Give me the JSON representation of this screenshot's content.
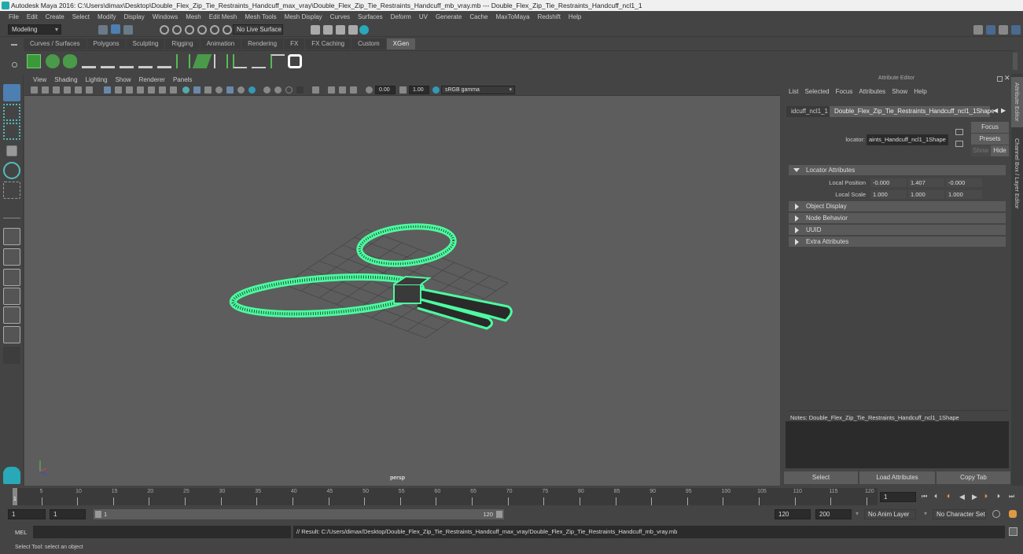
{
  "window": {
    "title": "Autodesk Maya 2016: C:\\Users\\dimax\\Desktop\\Double_Flex_Zip_Tie_Restraints_Handcuff_max_vray\\Double_Flex_Zip_Tie_Restraints_Handcuff_mb_vray.mb  ---  Double_Flex_Zip_Tie_Restraints_Handcuff_ncl1_1"
  },
  "menubar": [
    "File",
    "Edit",
    "Create",
    "Select",
    "Modify",
    "Display",
    "Windows",
    "Mesh",
    "Edit Mesh",
    "Mesh Tools",
    "Mesh Display",
    "Curves",
    "Surfaces",
    "Deform",
    "UV",
    "Generate",
    "Cache",
    "MaxToMaya",
    "Redshift",
    "Help"
  ],
  "statusline": {
    "mode": "Modeling",
    "live_surface": "No Live Surface"
  },
  "shelf": {
    "tabs": [
      "Curves / Surfaces",
      "Polygons",
      "Sculpting",
      "Rigging",
      "Animation",
      "Rendering",
      "FX",
      "FX Caching",
      "Custom",
      "XGen"
    ],
    "active_tab": "XGen",
    "icons": [
      "xgen-library-icon",
      "xgen-preview-icon",
      "xgen-clear-icon",
      "xgen-add-guides-icon",
      "xgen-place-icon",
      "xgen-add-icon",
      "xgen-visibility-icon",
      "xgen-lock-icon",
      "xgen-grass-icon",
      "xgen-layer-icon",
      "xgen-sculpt-icon",
      "xgen-select-icon",
      "xgen-comb-icon",
      "xgen-delete-icon",
      "xgen-logo-icon"
    ]
  },
  "viewport": {
    "menu": [
      "View",
      "Shading",
      "Lighting",
      "Show",
      "Renderer",
      "Panels"
    ],
    "exposure": "0.00",
    "gamma": "1.00",
    "color_space": "sRGB gamma",
    "camera_label": "persp",
    "wire_color": "#4dfca0"
  },
  "attribute_editor": {
    "title": "Attribute Editor",
    "menu": [
      "List",
      "Selected",
      "Focus",
      "Attributes",
      "Show",
      "Help"
    ],
    "tabs": [
      "idcuff_ncl1_1",
      "Double_Flex_Zip_Tie_Restraints_Handcuff_ncl1_1Shape"
    ],
    "active_tab": 1,
    "node_type_label": "locator:",
    "node_name": "aints_Handcuff_ncl1_1Shape",
    "buttons": {
      "focus": "Focus",
      "presets": "Presets",
      "show": "Show",
      "hide": "Hide"
    },
    "sections": [
      {
        "label": "Locator Attributes",
        "expanded": true
      },
      {
        "label": "Object Display",
        "expanded": false
      },
      {
        "label": "Node Behavior",
        "expanded": false
      },
      {
        "label": "UUID",
        "expanded": false
      },
      {
        "label": "Extra Attributes",
        "expanded": false
      }
    ],
    "local_position": {
      "label": "Local Position",
      "values": [
        "-0.000",
        "1.407",
        "-0.000"
      ]
    },
    "local_scale": {
      "label": "Local Scale",
      "values": [
        "1.000",
        "1.000",
        "1.000"
      ]
    },
    "notes_label": "Notes:  Double_Flex_Zip_Tie_Restraints_Handcuff_ncl1_1Shape",
    "bottom_buttons": [
      "Select",
      "Load Attributes",
      "Copy Tab"
    ]
  },
  "side_tabs": [
    "Attribute Editor",
    "Channel Box / Layer Editor"
  ],
  "timeline": {
    "ticks": [
      "5",
      "10",
      "15",
      "20",
      "25",
      "30",
      "35",
      "40",
      "45",
      "50",
      "55",
      "60",
      "65",
      "70",
      "75",
      "80",
      "85",
      "90",
      "95",
      "100",
      "105",
      "110",
      "115",
      "120"
    ],
    "current_frame_marker": "1",
    "current_frame": "1"
  },
  "range": {
    "start": "1",
    "playback_start": "1",
    "slider_start": "1",
    "slider_end": "120",
    "playback_end": "120",
    "end": "200",
    "anim_layer": "No Anim Layer",
    "character_set": "No Character Set"
  },
  "command_line": {
    "language": "MEL",
    "result": "// Result: C:/Users/dimax/Desktop/Double_Flex_Zip_Tie_Restraints_Handcuff_max_vray/Double_Flex_Zip_Tie_Restraints_Handcuff_mb_vray.mb"
  },
  "help_line": "Select Tool: select an object"
}
